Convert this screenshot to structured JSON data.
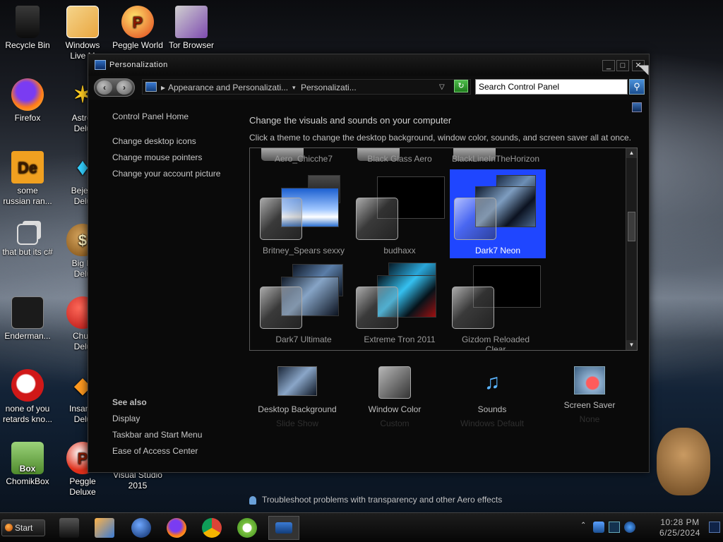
{
  "desktop": {
    "icons": [
      {
        "label": "Recycle Bin"
      },
      {
        "label": "Windows\nLive M"
      },
      {
        "label": "Peggle World"
      },
      {
        "label": "Tor Browser"
      },
      {
        "label": "Firefox"
      },
      {
        "label": "Astrol\nDelu"
      },
      {
        "label": "some\nrussian ran..."
      },
      {
        "label": "Bejew\nDelu"
      },
      {
        "label": "that but its c#"
      },
      {
        "label": "Big M\nDelu"
      },
      {
        "label": "Enderman..."
      },
      {
        "label": "Chuz\nDelu"
      },
      {
        "label": "none of you\nretards kno..."
      },
      {
        "label": "Insanic\nDelu"
      },
      {
        "label": "ChomikBox"
      },
      {
        "label": "Peggle\nDeluxe"
      },
      {
        "label": "Visual Studio\n2015"
      }
    ]
  },
  "window": {
    "title": "Personalization",
    "address": {
      "crumb1": "Appearance and Personalizati...",
      "crumb2": "Personalizati..."
    },
    "search": {
      "value": "Search Control Panel"
    }
  },
  "left_pane": {
    "home": "Control Panel Home",
    "links": [
      "Change desktop icons",
      "Change mouse pointers",
      "Change your account picture"
    ],
    "see_also_header": "See also",
    "see_also": [
      "Display",
      "Taskbar and Start Menu",
      "Ease of Access Center"
    ]
  },
  "main": {
    "heading": "Change the visuals and sounds on your computer",
    "subheading": "Click a theme to change the desktop background, window color, sounds, and screen saver all at once.",
    "themes_row0": [
      "Aero_Chicche7",
      "Black Glass Aero",
      "BlackLineInTheHorizon"
    ],
    "themes": [
      {
        "name": "Britney_Spears sexxy",
        "selected": false
      },
      {
        "name": "budhaxx",
        "selected": false
      },
      {
        "name": "Dark7 Neon",
        "selected": true
      },
      {
        "name": "Dark7 Ultimate",
        "selected": false
      },
      {
        "name": "Extreme Tron 2011",
        "selected": false
      },
      {
        "name": "Gizdom Reloaded\nClear",
        "selected": false
      }
    ],
    "settings": [
      {
        "title": "Desktop Background",
        "value": "Slide Show",
        "icon": "desktop-background-icon"
      },
      {
        "title": "Window Color",
        "value": "Custom",
        "icon": "window-color-icon"
      },
      {
        "title": "Sounds",
        "value": "Windows Default",
        "icon": "sounds-icon"
      },
      {
        "title": "Screen Saver",
        "value": "None",
        "icon": "screen-saver-icon"
      }
    ],
    "troubleshoot": "Troubleshoot problems with transparency and other Aero effects"
  },
  "taskbar": {
    "start_label": "Start",
    "time": "10:28 PM",
    "date": "6/25/2024"
  },
  "colors": {
    "selection": "#1f46ff",
    "window_bg": "#0a0a0a",
    "taskbar": "#111111"
  }
}
